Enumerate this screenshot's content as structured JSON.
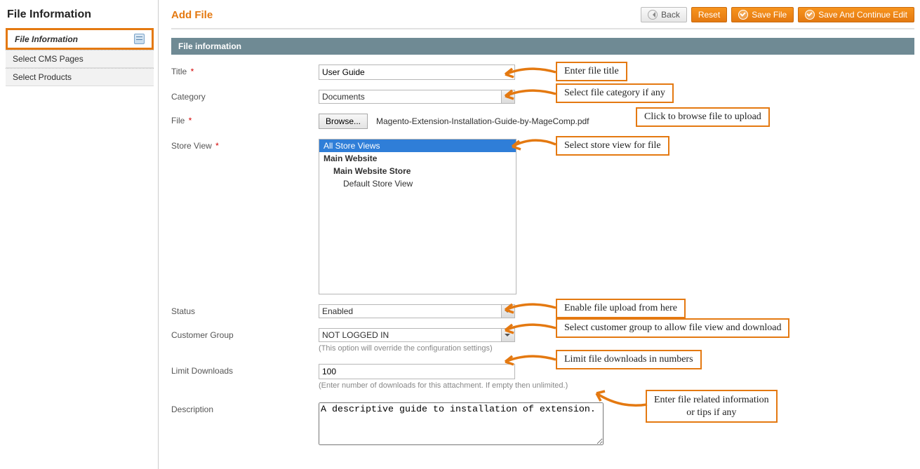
{
  "sidebar": {
    "title": "File Information",
    "items": [
      {
        "label": "File Information"
      },
      {
        "label": "Select CMS Pages"
      },
      {
        "label": "Select Products"
      }
    ]
  },
  "header": {
    "page_title": "Add File",
    "buttons": {
      "back": "Back",
      "reset": "Reset",
      "save": "Save File",
      "save_continue": "Save And Continue Edit"
    }
  },
  "section": {
    "title": "File information"
  },
  "form": {
    "title": {
      "label": "Title",
      "value": "User Guide"
    },
    "category": {
      "label": "Category",
      "selected": "Documents"
    },
    "file": {
      "label": "File",
      "browse": "Browse...",
      "filename": "Magento-Extension-Installation-Guide-by-MageComp.pdf"
    },
    "store_view": {
      "label": "Store View",
      "options": [
        {
          "text": "All Store Views",
          "selected": true,
          "level": 0
        },
        {
          "text": "Main Website",
          "level": 0,
          "group": true
        },
        {
          "text": "Main Website Store",
          "level": 1,
          "group": true
        },
        {
          "text": "Default Store View",
          "level": 2
        }
      ]
    },
    "status": {
      "label": "Status",
      "selected": "Enabled"
    },
    "customer_group": {
      "label": "Customer Group",
      "selected": "NOT LOGGED IN",
      "hint": "(This option will override the configuration settings)"
    },
    "limit_downloads": {
      "label": "Limit Downloads",
      "value": "100",
      "hint": "(Enter number of downloads for this attachment. If empty then unlimited.)"
    },
    "description": {
      "label": "Description",
      "value": "A descriptive guide to installation of extension."
    }
  },
  "annotations": {
    "title": "Enter file title",
    "category": "Select file category if any",
    "file": "Click to browse file to upload",
    "store_view": "Select store view for file",
    "status": "Enable file upload from here",
    "customer_group": "Select customer group to allow file view and download",
    "limit_downloads": "Limit file downloads in numbers",
    "description": "Enter file related information\nor tips if any"
  }
}
